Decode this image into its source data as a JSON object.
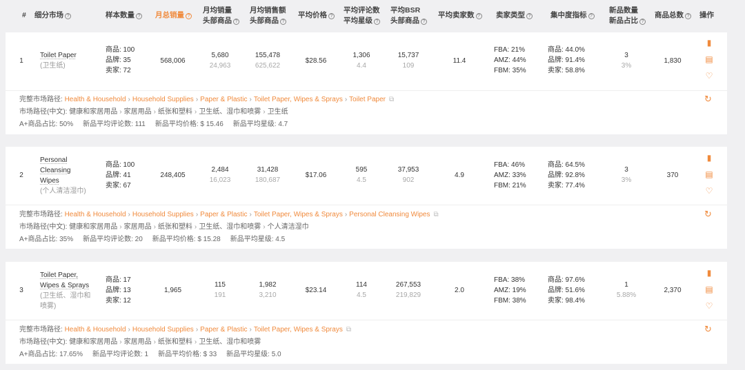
{
  "headers": {
    "idx": "#",
    "segment": "细分市场",
    "sample": "样本数量",
    "monthly_sales": "月总销量",
    "monthly_units_l1": "月均销量",
    "monthly_units_l2": "头部商品",
    "monthly_rev_l1": "月均销售额",
    "monthly_rev_l2": "头部商品",
    "avg_price": "平均价格",
    "avg_reviews_l1": "平均评论数",
    "avg_reviews_l2": "平均星级",
    "avg_bsr_l1": "平均BSR",
    "avg_bsr_l2": "头部商品",
    "avg_sellers": "平均卖家数",
    "seller_type": "卖家类型",
    "concentration": "集中度指标",
    "new_l1": "新品数量",
    "new_l2": "新品占比",
    "total": "商品总数",
    "ops": "操作"
  },
  "help_glyph": "?",
  "ops_icons": [
    "bar-chart-icon",
    "document-icon",
    "heart-icon"
  ],
  "rows": [
    {
      "idx": "1",
      "name_en": [
        "Toilet Paper"
      ],
      "name_zh": [
        "(卫生纸)"
      ],
      "sample": [
        "商品: 100",
        "品牌: 35",
        "卖家: 72"
      ],
      "monthly_sales": "568,006",
      "units_main": "5,680",
      "units_sub": "24,963",
      "rev_main": "155,478",
      "rev_sub": "625,622",
      "price": "$28.56",
      "reviews_main": "1,306",
      "reviews_sub": "4.4",
      "bsr_main": "15,737",
      "bsr_sub": "109",
      "sellers": "11.4",
      "seller_type": [
        "FBA: 21%",
        "AMZ: 44%",
        "FBM: 35%"
      ],
      "concentration": [
        "商品: 44.0%",
        "品牌: 91.4%",
        "卖家: 58.8%"
      ],
      "new_main": "3",
      "new_sub": "3%",
      "total": "1,830",
      "path_label": "完整市场路径:",
      "path": [
        "Health & Household",
        "Household Supplies",
        "Paper & Plastic",
        "Toilet Paper, Wipes & Sprays",
        "Toilet Paper"
      ],
      "path_zh_label": "市场路径(中文):",
      "path_zh": [
        "健康和家居用品",
        "家居用品",
        "纸张和塑料",
        "卫生纸、湿巾和喷雾",
        "卫生纸"
      ],
      "stats": [
        "A+商品占比: 50%",
        "新品平均评论数: 111",
        "新品平均价格: $ 15.46",
        "新品平均星级: 4.7"
      ]
    },
    {
      "idx": "2",
      "name_en": [
        "Personal",
        "Cleansing",
        "Wipes"
      ],
      "name_zh": [
        "(个人清洁湿巾)"
      ],
      "sample": [
        "商品: 100",
        "品牌: 41",
        "卖家: 67"
      ],
      "monthly_sales": "248,405",
      "units_main": "2,484",
      "units_sub": "16,023",
      "rev_main": "31,428",
      "rev_sub": "180,687",
      "price": "$17.06",
      "reviews_main": "595",
      "reviews_sub": "4.5",
      "bsr_main": "37,953",
      "bsr_sub": "902",
      "sellers": "4.9",
      "seller_type": [
        "FBA: 46%",
        "AMZ: 33%",
        "FBM: 21%"
      ],
      "concentration": [
        "商品: 64.5%",
        "品牌: 92.8%",
        "卖家: 77.4%"
      ],
      "new_main": "3",
      "new_sub": "3%",
      "total": "370",
      "path_label": "完整市场路径:",
      "path": [
        "Health & Household",
        "Household Supplies",
        "Paper & Plastic",
        "Toilet Paper, Wipes & Sprays",
        "Personal Cleansing Wipes"
      ],
      "path_zh_label": "市场路径(中文):",
      "path_zh": [
        "健康和家居用品",
        "家居用品",
        "纸张和塑料",
        "卫生纸、湿巾和喷雾",
        "个人清洁湿巾"
      ],
      "stats": [
        "A+商品占比: 35%",
        "新品平均评论数: 20",
        "新品平均价格: $ 15.28",
        "新品平均星级: 4.5"
      ]
    },
    {
      "idx": "3",
      "name_en": [
        "Toilet Paper,",
        "Wipes & Sprays"
      ],
      "name_zh": [
        "(卫生纸、湿巾和",
        "喷雾)"
      ],
      "sample": [
        "商品: 17",
        "品牌: 13",
        "卖家: 12"
      ],
      "monthly_sales": "1,965",
      "units_main": "115",
      "units_sub": "191",
      "rev_main": "1,982",
      "rev_sub": "3,210",
      "price": "$23.14",
      "reviews_main": "114",
      "reviews_sub": "4.5",
      "bsr_main": "267,553",
      "bsr_sub": "219,829",
      "sellers": "2.0",
      "seller_type": [
        "FBA: 38%",
        "AMZ: 19%",
        "FBM: 38%"
      ],
      "concentration": [
        "商品: 97.6%",
        "品牌: 51.6%",
        "卖家: 98.4%"
      ],
      "new_main": "1",
      "new_sub": "5.88%",
      "total": "2,370",
      "path_label": "完整市场路径:",
      "path": [
        "Health & Household",
        "Household Supplies",
        "Paper & Plastic",
        "Toilet Paper, Wipes & Sprays"
      ],
      "path_zh_label": "市场路径(中文):",
      "path_zh": [
        "健康和家居用品",
        "家居用品",
        "纸张和塑料",
        "卫生纸、湿巾和喷雾"
      ],
      "stats": [
        "A+商品占比: 17.65%",
        "新品平均评论数: 1",
        "新品平均价格: $ 33",
        "新品平均星级: 5.0"
      ]
    }
  ],
  "colors": {
    "accent": "#f08a3c",
    "muted": "#a8a8a8",
    "bg": "#f0f0f2"
  }
}
